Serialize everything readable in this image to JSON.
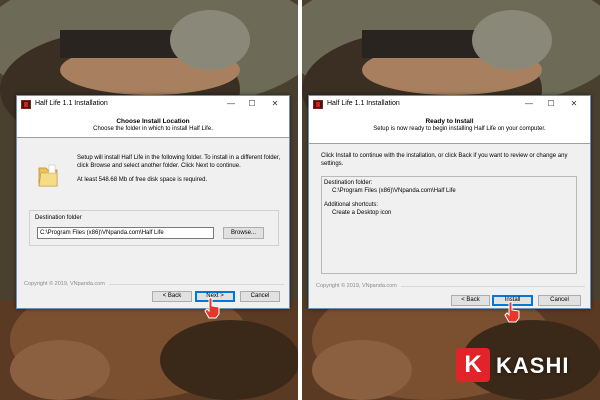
{
  "colors": {
    "accent": "#0078d7",
    "logo_red": "#e2232a"
  },
  "left_dialog": {
    "title": "Half Life 1.1 Installation",
    "header_title": "Choose Install Location",
    "header_subtitle": "Choose the folder in which to install Half Life.",
    "intro_text": "Setup will install Half Life in the following folder. To install in a different folder, click Browse and select another folder. Click Next to continue.",
    "space_text": "At least 548.68 Mb of free disk space is required.",
    "destination_label": "Destination folder",
    "destination_value": "C:\\Program Files (x86)\\VNpanda.com\\Half Life",
    "browse_label": "Browse...",
    "copyright": "Copyright © 2019, VNpanda.com",
    "back_label": "< Back",
    "next_label": "Next >",
    "cancel_label": "Cancel"
  },
  "right_dialog": {
    "title": "Half Life 1.1 Installation",
    "header_title": "Ready to Install",
    "header_subtitle": "Setup is now ready to begin installing Half Life on your computer.",
    "intro_text": "Click Install to continue with the installation, or click Back if you want to review or change any settings.",
    "summary_line1": "Destination folder:",
    "summary_line2": "C:\\Program Files (x86)\\VNpanda.com\\Half Life",
    "summary_line3": "Additional shortcuts:",
    "summary_line4": "Create a Desktop icon",
    "copyright": "Copyright © 2019, VNpanda.com",
    "back_label": "< Back",
    "install_label": "Install",
    "cancel_label": "Cancel"
  },
  "window_controls": {
    "minimize": "—",
    "maximize": "☐",
    "close": "✕"
  },
  "logo": {
    "letter": "K",
    "text": "KASHI"
  }
}
